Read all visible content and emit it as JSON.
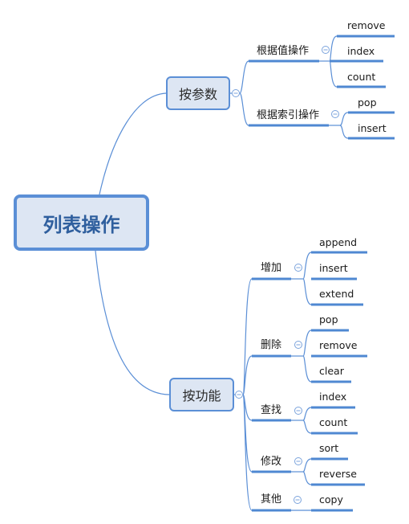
{
  "root": {
    "label": "列表操作"
  },
  "colors": {
    "accent": "#4f88d2",
    "node_fill": "#dde6f3",
    "root_text": "#2f5f9e"
  },
  "branches": [
    {
      "label": "按参数",
      "groups": [
        {
          "label": "根据值操作",
          "items": [
            "remove",
            "index",
            "count"
          ]
        },
        {
          "label": "根据索引操作",
          "items": [
            "pop",
            "insert"
          ]
        }
      ]
    },
    {
      "label": "按功能",
      "groups": [
        {
          "label": "增加",
          "items": [
            "append",
            "insert",
            "extend"
          ]
        },
        {
          "label": "删除",
          "items": [
            "pop",
            "remove",
            "clear"
          ]
        },
        {
          "label": "查找",
          "items": [
            "index",
            "count"
          ]
        },
        {
          "label": "修改",
          "items": [
            "sort",
            "reverse"
          ]
        },
        {
          "label": "其他",
          "items": [
            "copy"
          ]
        }
      ]
    }
  ]
}
